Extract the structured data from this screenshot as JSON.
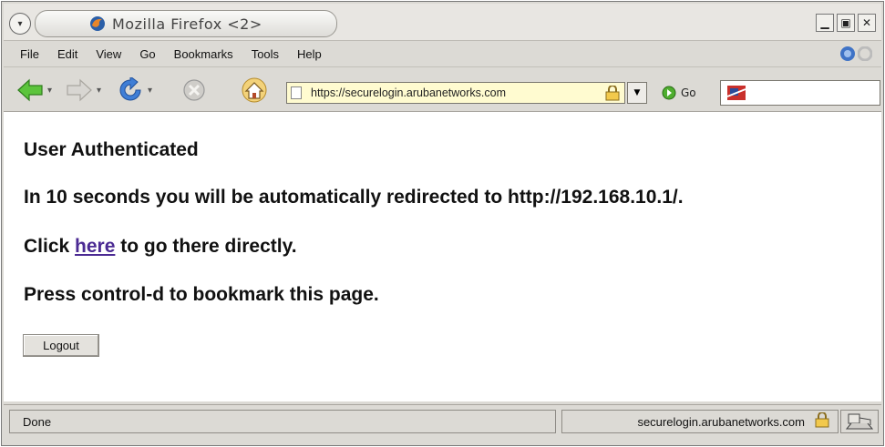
{
  "window": {
    "title": "Mozilla Firefox <2>"
  },
  "menubar": {
    "items": [
      "File",
      "Edit",
      "View",
      "Go",
      "Bookmarks",
      "Tools",
      "Help"
    ]
  },
  "toolbar": {
    "url": "https://securelogin.arubanetworks.com",
    "go_label": "Go",
    "icons": [
      "back-icon",
      "forward-icon",
      "reload-icon",
      "stop-icon",
      "home-icon"
    ]
  },
  "content": {
    "heading": "User Authenticated",
    "redirect_text": "In 10 seconds you will be automatically redirected to http://192.168.10.1/.",
    "click_prefix": "Click ",
    "here_link": "here",
    "click_suffix": " to go there directly.",
    "bookmark_text": "Press control-d to bookmark this page.",
    "logout_label": "Logout"
  },
  "statusbar": {
    "status": "Done",
    "host": "securelogin.arubanetworks.com"
  },
  "colors": {
    "link": "#4b2a93",
    "url_background": "#fffbd0",
    "chrome": "#dcdad5"
  }
}
